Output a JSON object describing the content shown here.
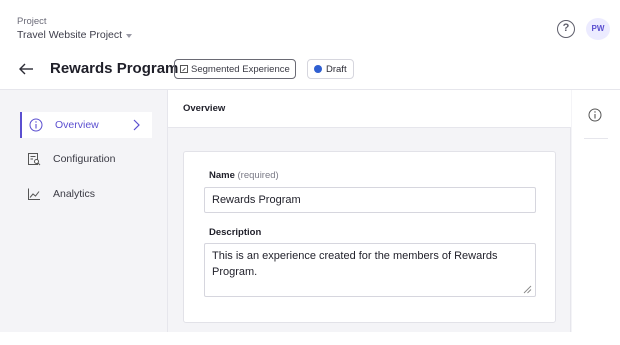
{
  "header": {
    "project_label": "Project",
    "project_name": "Travel Website Project",
    "help_glyph": "?",
    "avatar_initials": "PW"
  },
  "titlebar": {
    "title": "Rewards Program",
    "segment_badge": "Segmented Experience",
    "status_badge": "Draft",
    "status_color": "#2f5fd1"
  },
  "sidebar": {
    "items": [
      {
        "label": "Overview",
        "icon": "info-icon",
        "active": true
      },
      {
        "label": "Configuration",
        "icon": "configuration-icon",
        "active": false
      },
      {
        "label": "Analytics",
        "icon": "analytics-icon",
        "active": false
      }
    ]
  },
  "main": {
    "heading": "Overview",
    "name_label": "Name",
    "name_hint": "(required)",
    "name_value": "Rewards Program",
    "description_label": "Description",
    "description_value": "This is an experience created for the members of Rewards Program."
  },
  "colors": {
    "accent": "#5b4fd0",
    "background": "#f4f4f7"
  }
}
